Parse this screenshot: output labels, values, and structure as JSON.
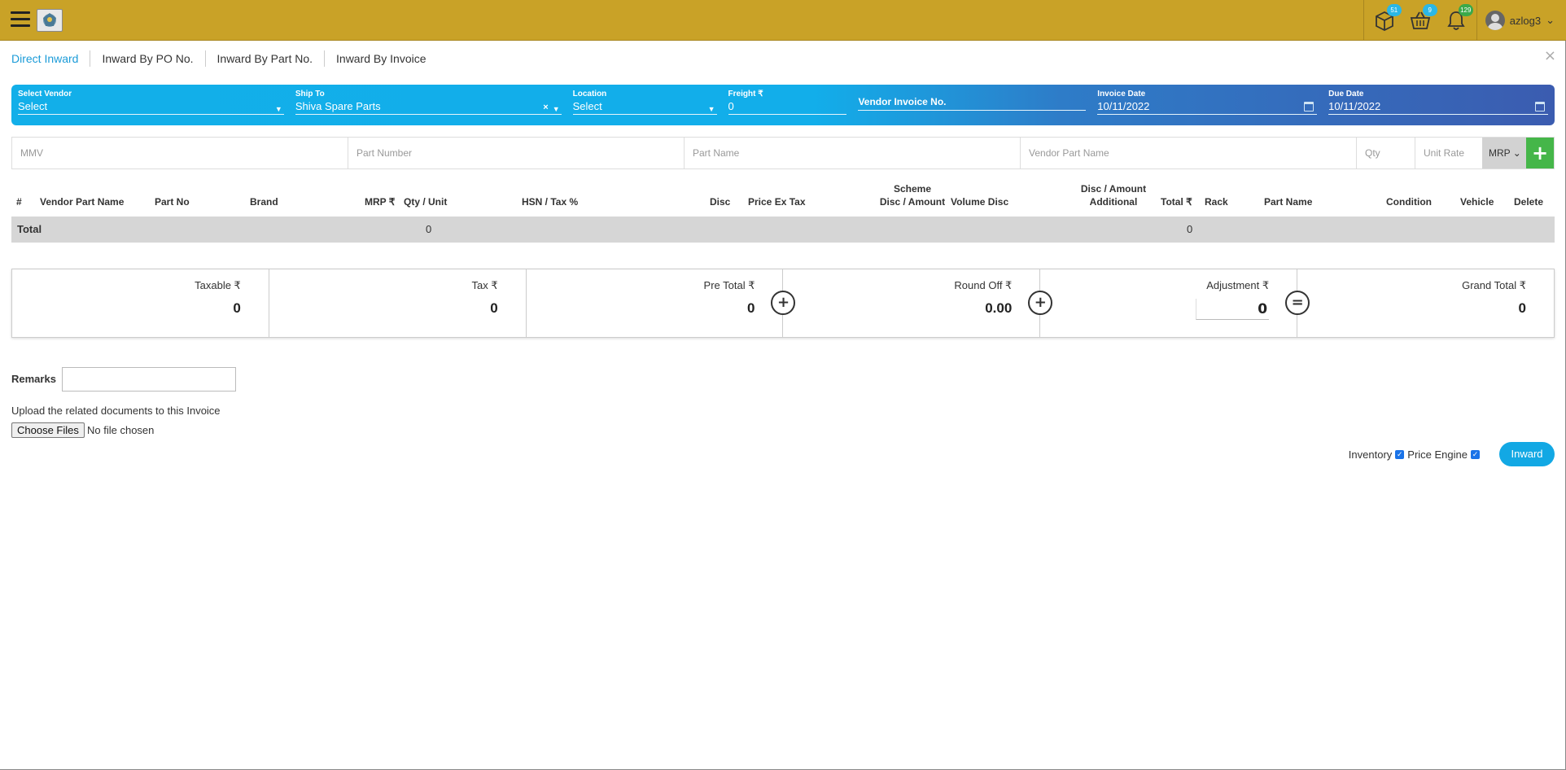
{
  "topbar": {
    "badges": {
      "inventory": "51",
      "cart": "9",
      "notifications": "129"
    },
    "user_name": "azlog3",
    "user_caret": "⌄"
  },
  "tabs": [
    "Direct Inward",
    "Inward By PO No.",
    "Inward By Part No.",
    "Inward By Invoice"
  ],
  "close": "×",
  "filters": {
    "vendor": {
      "label": "Select Vendor",
      "value": "Select"
    },
    "ship_to": {
      "label": "Ship To",
      "value": "Shiva Spare Parts",
      "clear": "×"
    },
    "location": {
      "label": "Location",
      "value": "Select"
    },
    "freight": {
      "label": "Freight ₹",
      "value": "0"
    },
    "vendor_invoice_placeholder": "Vendor Invoice No.",
    "invoice_date": {
      "label": "Invoice Date",
      "value": "10/11/2022"
    },
    "due_date": {
      "label": "Due Date",
      "value": "10/11/2022"
    }
  },
  "entry": {
    "mmv": "MMV",
    "part_number": "Part Number",
    "part_name": "Part Name",
    "vendor_part_name": "Vendor Part Name",
    "qty": "Qty",
    "unit_rate": "Unit Rate",
    "price_type": "MRP",
    "add": "+"
  },
  "table": {
    "headers": {
      "hash": "#",
      "vendor_part_name": "Vendor Part Name",
      "part_no": "Part No",
      "brand": "Brand",
      "mrp": "MRP ₹",
      "qty_unit": "Qty / Unit",
      "hsn_tax": "HSN / Tax %",
      "disc": "Disc",
      "price_ex_tax": "Price Ex Tax",
      "scheme_1": "Scheme",
      "scheme_2": "Disc / Amount",
      "volume_disc": "Volume Disc",
      "disc_amount_1": "Disc / Amount",
      "disc_amount_2": "Additional",
      "total": "Total ₹",
      "rack": "Rack",
      "part_name": "Part Name",
      "condition": "Condition",
      "vehicle": "Vehicle",
      "delete": "Delete"
    },
    "total_row": {
      "label": "Total",
      "qty": "0",
      "total": "0"
    }
  },
  "summary": {
    "taxable": {
      "label": "Taxable ₹",
      "value": "0"
    },
    "tax": {
      "label": "Tax ₹",
      "value": "0"
    },
    "pre_total": {
      "label": "Pre Total ₹",
      "value": "0"
    },
    "round_off": {
      "label": "Round Off ₹",
      "value": "0.00"
    },
    "adjustment": {
      "label": "Adjustment ₹",
      "value": "0"
    },
    "grand_total": {
      "label": "Grand Total ₹",
      "value": "0"
    },
    "ops": {
      "plus": "+",
      "equals": "="
    }
  },
  "remarks_label": "Remarks",
  "upload": {
    "text": "Upload the related documents to this Invoice",
    "button": "Choose Files",
    "status": "No file chosen"
  },
  "options": {
    "inventory": "Inventory",
    "price_engine": "Price Engine",
    "check": "✓"
  },
  "inward_button": "Inward"
}
